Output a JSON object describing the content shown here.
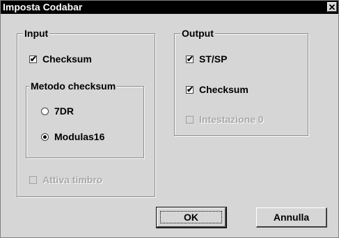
{
  "window": {
    "title": "Imposta Codabar",
    "close_glyph": "✕"
  },
  "input_group": {
    "legend": "Input",
    "checksum": {
      "label": "Checksum",
      "checked": true
    },
    "method_group": {
      "legend": "Metodo checksum",
      "options": [
        {
          "label": "7DR",
          "selected": false
        },
        {
          "label": "Modulas16",
          "selected": true
        }
      ]
    },
    "stamp": {
      "label": "Attiva timbro",
      "checked": false,
      "disabled": true
    }
  },
  "output_group": {
    "legend": "Output",
    "stsp": {
      "label": "ST/SP",
      "checked": true
    },
    "checksum": {
      "label": "Checksum",
      "checked": true
    },
    "header_zero": {
      "label": "Intestazione 0",
      "checked": false,
      "disabled": true
    }
  },
  "buttons": {
    "ok": "OK",
    "cancel": "Annulla"
  },
  "icons": {
    "check": "✔"
  }
}
